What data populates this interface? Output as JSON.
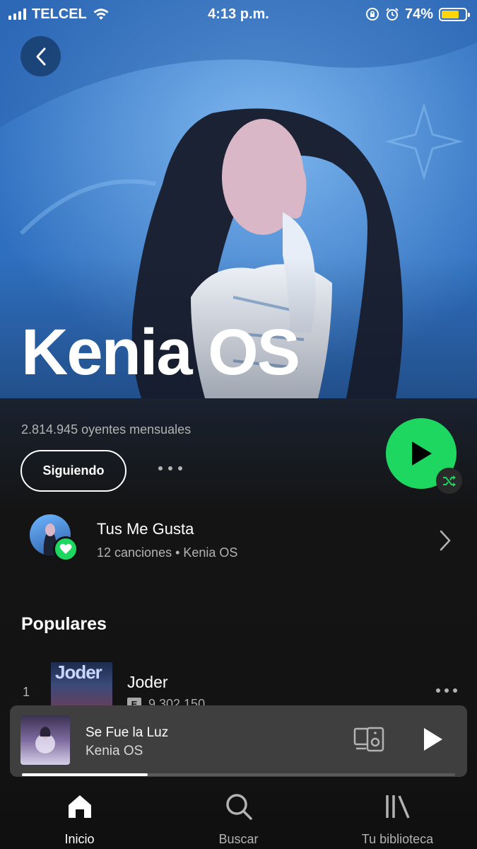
{
  "status_bar": {
    "carrier": "TELCEL",
    "time": "4:13 p.m.",
    "battery_pct": "74%",
    "battery_level": 0.74,
    "icons": [
      "signal-icon",
      "wifi-icon",
      "orientation-lock-icon",
      "alarm-icon",
      "battery-icon"
    ]
  },
  "header": {
    "artist_name": "Kenia OS",
    "back_icon": "chevron-left-icon"
  },
  "artist": {
    "monthly_listeners": "2.814.945 oyentes mensuales",
    "follow_label": "Siguiendo"
  },
  "liked_songs": {
    "title": "Tus Me Gusta",
    "subtitle": "12 canciones • Kenia OS"
  },
  "popular": {
    "section_title": "Populares",
    "tracks": [
      {
        "number": "1",
        "title": "Joder",
        "cover_text": "Joder",
        "plays": "9.302.150",
        "explicit": "E"
      }
    ]
  },
  "now_playing": {
    "song": "Se Fue la Luz",
    "artist": "Kenia OS",
    "progress": 0.29
  },
  "nav": {
    "home": "Inicio",
    "search": "Buscar",
    "library": "Tu biblioteca"
  },
  "colors": {
    "accent": "#1ed760",
    "background": "#121212",
    "hero_blue": "#3f86d6"
  }
}
